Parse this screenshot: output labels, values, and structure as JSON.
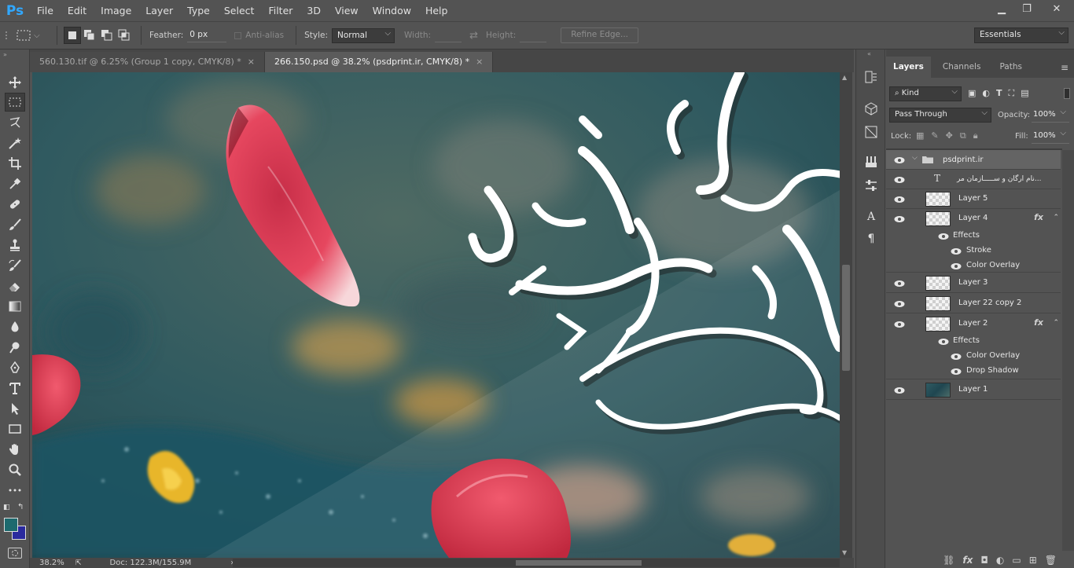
{
  "app": {
    "logo": "Ps"
  },
  "menu": [
    "File",
    "Edit",
    "Image",
    "Layer",
    "Type",
    "Select",
    "Filter",
    "3D",
    "View",
    "Window",
    "Help"
  ],
  "window_controls": {
    "minimize": "▁",
    "restore": "❐",
    "close": "✕"
  },
  "options_bar": {
    "feather_label": "Feather:",
    "feather_value": "0 px",
    "antialias_label": "Anti-alias",
    "style_label": "Style:",
    "style_value": "Normal",
    "width_label": "Width:",
    "height_label": "Height:",
    "refine_edge": "Refine Edge...",
    "workspace": "Essentials"
  },
  "doc_tabs": [
    {
      "label": "560.130.tif @ 6.25% (Group 1 copy, CMYK/8) *",
      "close": "×"
    },
    {
      "label": "266.150.psd @ 38.2% (psdprint.ir, CMYK/8) *",
      "close": "×"
    }
  ],
  "status": {
    "zoom": "38.2%",
    "doc": "Doc: 122.3M/155.9M",
    "arrow": "›"
  },
  "canvas": {
    "calligraphy": "نارد هشید شده"
  },
  "colors": {
    "foreground": "#1d6a6e",
    "background": "#2a2a9e",
    "accent": "#31a8ff"
  },
  "layers_panel": {
    "tabs": [
      "Layers",
      "Channels",
      "Paths"
    ],
    "filter_kind": "Kind",
    "blend_mode": "Pass Through",
    "opacity_label": "Opacity:",
    "opacity_value": "100%",
    "lock_label": "Lock:",
    "fill_label": "Fill:",
    "fill_value": "100%",
    "group_name": "psdprint.ir",
    "text_layer_name": "نام ارگان و ســـــازمان مر...",
    "layers": [
      {
        "name": "Layer 5"
      },
      {
        "name": "Layer 4",
        "fx": "fx"
      },
      {
        "name": "Layer 3"
      },
      {
        "name": "Layer 22 copy 2"
      },
      {
        "name": "Layer 2",
        "fx": "fx"
      },
      {
        "name": "Layer 1"
      }
    ],
    "layer4_effects": {
      "label": "Effects",
      "items": [
        "Stroke",
        "Color Overlay"
      ]
    },
    "layer2_effects": {
      "label": "Effects",
      "items": [
        "Color Overlay",
        "Drop Shadow"
      ]
    }
  }
}
